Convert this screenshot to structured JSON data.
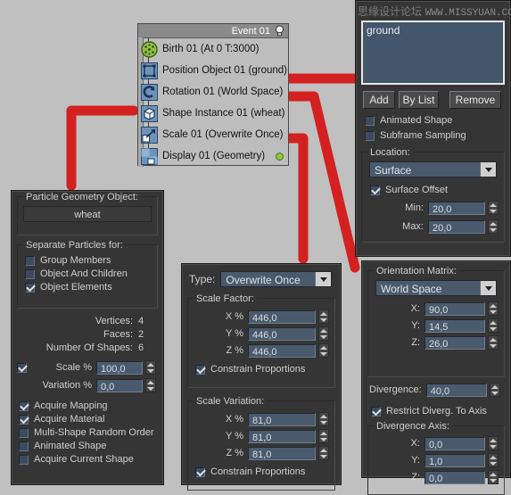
{
  "background_color": "#c0c0c0",
  "accent_color": "#d42020",
  "watermark": {
    "cn": "思缘设计论坛",
    "en": "WWW.MISSYUAN.COM"
  },
  "particle_view": {
    "event_title": "Event 01",
    "lightbulb_icon": "lightbulb-icon",
    "operators": [
      {
        "icon": "birth-icon",
        "label": "Birth 01 (At 0 T:3000)"
      },
      {
        "icon": "position-object-icon",
        "label": "Position Object 01 (ground)"
      },
      {
        "icon": "rotation-icon",
        "label": "Rotation 01 (World Space)"
      },
      {
        "icon": "shape-instance-icon",
        "label": "Shape Instance 01 (wheat)"
      },
      {
        "icon": "scale-icon",
        "label": "Scale 01 (Overwrite Once)"
      },
      {
        "icon": "display-icon",
        "label": "Display 01 (Geometry)"
      }
    ]
  },
  "shape_instance_panel": {
    "group_title": "Particle Geometry Object:",
    "object_name": "wheat",
    "separate_group_title": "Separate Particles for:",
    "separate_options": [
      {
        "label": "Group Members",
        "checked": false
      },
      {
        "label": "Object And Children",
        "checked": false
      },
      {
        "label": "Object Elements",
        "checked": true
      }
    ],
    "stats": [
      {
        "label": "Vertices:",
        "value": "4"
      },
      {
        "label": "Faces:",
        "value": "2"
      },
      {
        "label": "Number Of Shapes:",
        "value": "6"
      }
    ],
    "scale": {
      "label": "Scale %",
      "value": "100,0",
      "checked": true
    },
    "variation": {
      "label": "Variation %",
      "value": "0,0"
    },
    "options": [
      {
        "label": "Acquire Mapping",
        "checked": true
      },
      {
        "label": "Acquire Material",
        "checked": true
      },
      {
        "label": "Multi-Shape Random Order",
        "checked": false
      },
      {
        "label": "Animated Shape",
        "checked": false
      },
      {
        "label": "Acquire Current Shape",
        "checked": false
      }
    ]
  },
  "position_object_panel": {
    "list_items": [
      "ground"
    ],
    "buttons": [
      "Add",
      "By List",
      "Remove"
    ],
    "checkboxes": [
      {
        "label": "Animated Shape",
        "checked": false
      },
      {
        "label": "Subframe Sampling",
        "checked": false
      }
    ],
    "location_group_title": "Location:",
    "location_value": "Surface",
    "surface_offset": {
      "label": "Surface Offset",
      "checked": true
    },
    "min": {
      "label": "Min:",
      "value": "20,0"
    },
    "max": {
      "label": "Max:",
      "value": "20,0"
    }
  },
  "scale_panel": {
    "type_label": "Type:",
    "type_value": "Overwrite Once",
    "scale_factor_title": "Scale Factor:",
    "scale_factor": [
      {
        "label": "X %",
        "value": "446,0"
      },
      {
        "label": "Y %",
        "value": "446,0"
      },
      {
        "label": "Z %",
        "value": "446,0"
      }
    ],
    "constrain_1": {
      "label": "Constrain Proportions",
      "checked": true
    },
    "scale_variation_title": "Scale Variation:",
    "scale_variation": [
      {
        "label": "X %",
        "value": "81,0"
      },
      {
        "label": "Y %",
        "value": "81,0"
      },
      {
        "label": "Z %",
        "value": "81,0"
      }
    ],
    "constrain_2": {
      "label": "Constrain Proportions",
      "checked": true
    }
  },
  "rotation_panel": {
    "group_title": "Orientation Matrix:",
    "matrix_value": "World Space",
    "axes": [
      {
        "label": "X:",
        "value": "90,0"
      },
      {
        "label": "Y:",
        "value": "14,5"
      },
      {
        "label": "Z:",
        "value": "26,0"
      }
    ],
    "divergence": {
      "label": "Divergence:",
      "value": "40,0"
    },
    "restrict": {
      "label": "Restrict Diverg. To Axis",
      "checked": true
    },
    "div_axis_title": "Divergence Axis:",
    "div_axes": [
      {
        "label": "X:",
        "value": "0,0"
      },
      {
        "label": "Y:",
        "value": "1,0"
      },
      {
        "label": "Z:",
        "value": "0,0"
      }
    ]
  }
}
